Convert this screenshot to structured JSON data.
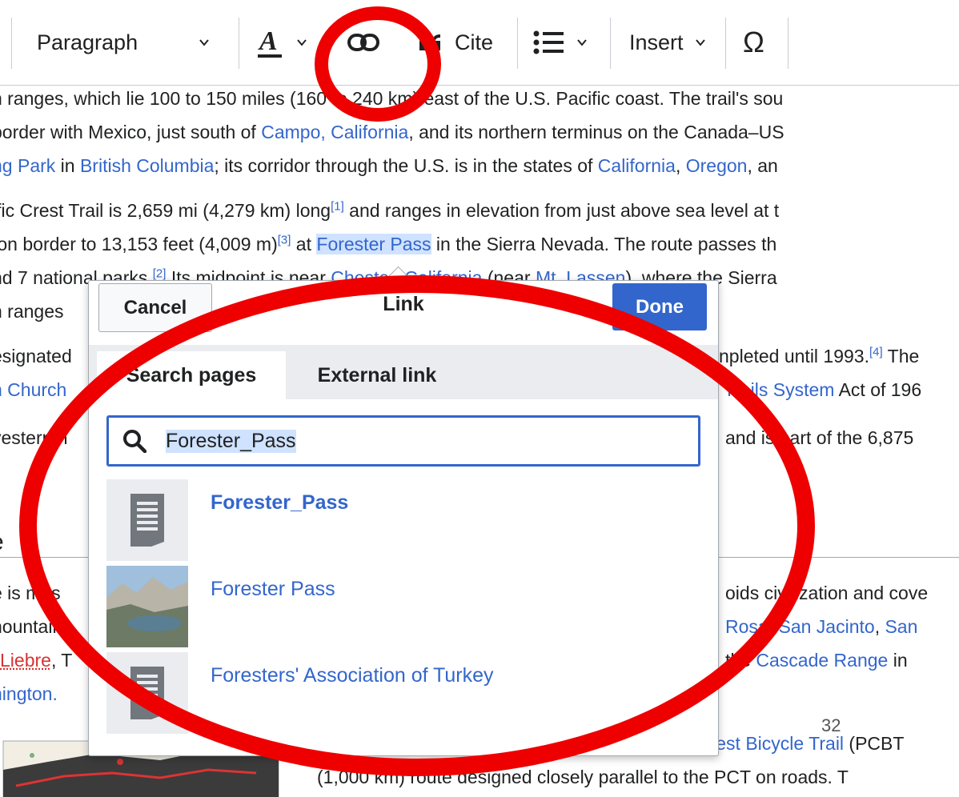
{
  "toolbar": {
    "paragraph_label": "Paragraph",
    "cite_label": "Cite",
    "insert_label": "Insert"
  },
  "article": {
    "lines": [
      {
        "parts": [
          "n ranges, which lie 100 to 150 miles (160 to 240 km) east of the U.S. Pacific coast. The trail's sou"
        ]
      },
      {
        "parts": [
          " border with Mexico, just south of ",
          "Campo, California",
          ", and its northern terminus on the Canada–US"
        ]
      },
      {
        "parts": [
          "ng Park",
          " in ",
          "British Columbia",
          "; its corridor through the U.S. is in the states of ",
          "California",
          ", ",
          "Oregon",
          ", an"
        ]
      },
      {
        "parts": [
          "ific Crest Trail is 2,659 mi (4,279 km) long",
          "[1]",
          " and ranges in elevation from just above sea level at t"
        ]
      },
      {
        "parts": [
          "ton border to 13,153 feet (4,009 m)",
          "[3]",
          " at ",
          "Forester Pass",
          " in the Sierra Nevada. The route passes th"
        ]
      },
      {
        "parts": [
          "nd 7 national parks.",
          "[2]",
          " Its midpoint is near ",
          "Chester, California",
          " (near ",
          "Mt. Lassen",
          "), where the Sierra"
        ]
      },
      {
        "parts": [
          "n ranges"
        ]
      },
      {
        "parts": [
          "esignated",
          "npleted until 1993.",
          "[4]",
          " The"
        ]
      },
      {
        "parts": [
          "n Church",
          "Trails System",
          " Act of 196"
        ]
      },
      {
        "parts": [
          "vesternm",
          "and is part of the 6,875"
        ]
      },
      {
        "parts": [
          "e is mos",
          "oids civilization and cove"
        ]
      },
      {
        "parts": [
          "nountains",
          "Rosa",
          ", ",
          "San Jacinto",
          ", ",
          "San"
        ]
      },
      {
        "parts": [
          "Liebre",
          ", T",
          "the ",
          "Cascade Range",
          " in "
        ]
      },
      {
        "parts": [
          "hington."
        ]
      },
      {
        "parts": [
          "Crest Bicycle Trail",
          " (PCBT"
        ]
      },
      {
        "parts": [
          "(1,000 km) route designed closely parallel to the PCT on roads. T"
        ]
      }
    ],
    "heading_fragment": "e",
    "page_number": "32"
  },
  "link_dialog": {
    "cancel_label": "Cancel",
    "title": "Link",
    "done_label": "Done",
    "tabs": [
      "Search pages",
      "External link"
    ],
    "active_tab": "Search pages",
    "search_value": "Forester_Pass",
    "results": [
      {
        "title": "Forester_Pass",
        "bold": true,
        "thumb": "page-icon"
      },
      {
        "title": "Forester Pass",
        "bold": false,
        "thumb": "mountain-photo"
      },
      {
        "title": "Foresters' Association of Turkey",
        "bold": false,
        "thumb": "page-icon"
      }
    ]
  },
  "colors": {
    "link": "#3366cc",
    "accent_button": "#3366cc",
    "annotation_red": "#ee0000",
    "selection": "#cfe2ff"
  }
}
